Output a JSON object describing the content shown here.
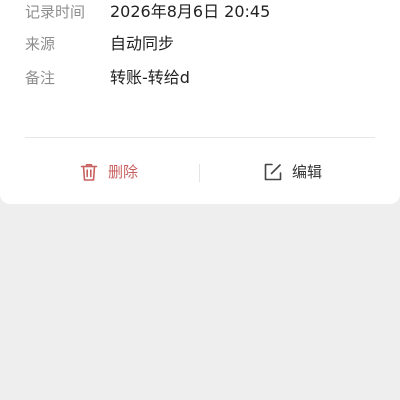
{
  "details": [
    {
      "label": "记录时间",
      "value": "2026年8月6日 20:45"
    },
    {
      "label": "来源",
      "value": "自动同步"
    },
    {
      "label": "备注",
      "value": "转账-转给d"
    }
  ],
  "actions": {
    "delete": {
      "label": "删除",
      "icon": "trash-icon",
      "color": "#c96060"
    },
    "edit": {
      "label": "编辑",
      "icon": "edit-icon",
      "color": "#333333"
    }
  },
  "colors": {
    "sheet_background": "#ffffff",
    "page_background": "#eeeeee",
    "label_text": "#8e8e8e",
    "value_text": "#222222"
  }
}
